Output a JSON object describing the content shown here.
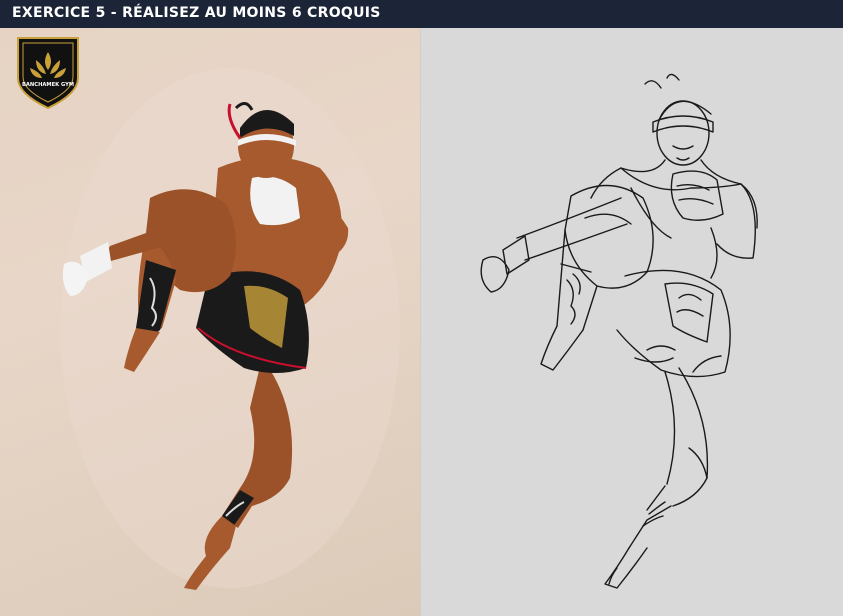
{
  "header": {
    "title": "EXERCICE 5 - RÉALISEZ AU MOINS 6 CROQUIS"
  },
  "logo": {
    "icon": "gym-shield-logo",
    "text": "BANCHAMEK GYM"
  },
  "colors": {
    "header_bg": "#1c2537",
    "photo_bg": "#e6d3c4",
    "sketch_bg": "#d9d9d9",
    "skin": "#a65a2e",
    "shorts": "#1a1a1a",
    "gold": "#c9a13b"
  }
}
